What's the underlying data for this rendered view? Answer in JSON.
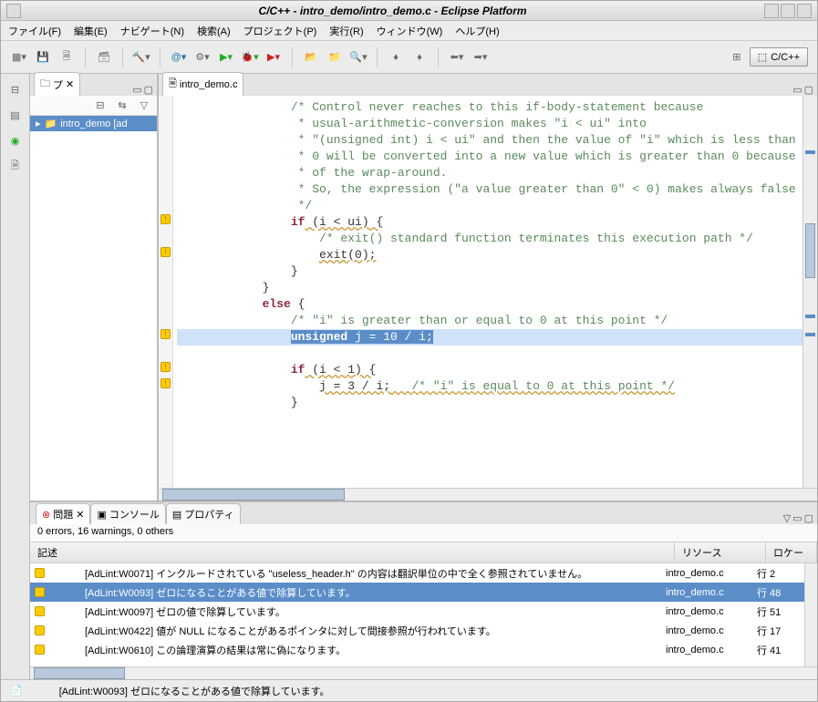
{
  "window": {
    "title": "C/C++ - intro_demo/intro_demo.c - Eclipse Platform"
  },
  "menu": {
    "file": "ファイル(F)",
    "edit": "編集(E)",
    "navigate": "ナビゲート(N)",
    "search": "検索(A)",
    "project": "プロジェクト(P)",
    "run": "実行(R)",
    "window": "ウィンドウ(W)",
    "help": "ヘルプ(H)"
  },
  "perspective": {
    "label": "C/C++"
  },
  "projectTab": "プ",
  "projectItem": "intro_demo [ad",
  "editor": {
    "tab": "intro_demo.c",
    "lines": [
      {
        "t": "comment",
        "indent": 16,
        "text": "/* Control never reaches to this if-body-statement because"
      },
      {
        "t": "comment",
        "indent": 17,
        "text": "* usual-arithmetic-conversion makes \"i < ui\" into"
      },
      {
        "t": "comment",
        "indent": 17,
        "text": "* \"(unsigned int) i < ui\" and then the value of \"i\" which is less than"
      },
      {
        "t": "comment",
        "indent": 17,
        "text": "* 0 will be converted into a new value which is greater than 0 because"
      },
      {
        "t": "comment",
        "indent": 17,
        "text": "* of the wrap-around."
      },
      {
        "t": "comment",
        "indent": 17,
        "text": "* So, the expression (\"a value greater than 0\" < 0) makes always false"
      },
      {
        "t": "comment",
        "indent": 17,
        "text": "*/"
      },
      {
        "t": "if1",
        "indent": 16,
        "kw": "if",
        "cond": " (i < ui) {"
      },
      {
        "t": "comment",
        "indent": 20,
        "text": "/* exit() standard function terminates this execution path */"
      },
      {
        "t": "call",
        "indent": 20,
        "text": "exit(0);"
      },
      {
        "t": "plain",
        "indent": 16,
        "text": "}"
      },
      {
        "t": "plain",
        "indent": 12,
        "text": "}"
      },
      {
        "t": "kw",
        "indent": 12,
        "kw": "else",
        "rest": " {"
      },
      {
        "t": "comment",
        "indent": 16,
        "text": "/* \"i\" is greater than or equal to 0 at this point */"
      },
      {
        "t": "hl",
        "indent": 16,
        "kw": "unsigned",
        "rest": " j = 10 / i;"
      },
      {
        "t": "blank"
      },
      {
        "t": "if2",
        "indent": 16,
        "kw": "if",
        "cond": " (i < 1) {"
      },
      {
        "t": "assign",
        "indent": 20,
        "lhs": "j = 3 / i;",
        "cmt": "   /* \"i\" is equal to 0 at this point */"
      },
      {
        "t": "plain",
        "indent": 16,
        "text": "}"
      }
    ]
  },
  "problemsTabs": {
    "problems": "問題",
    "console": "コンソール",
    "properties": "プロパティ"
  },
  "problemsSummary": "0 errors, 16 warnings, 0 others",
  "problemsCols": {
    "desc": "記述",
    "res": "リソース",
    "loc": "ロケー"
  },
  "problems": [
    {
      "desc": "[AdLint:W0071] インクルードされている \"useless_header.h\" の内容は翻訳単位の中で全く参照されていません。",
      "res": "intro_demo.c",
      "loc": "行 2",
      "sel": false
    },
    {
      "desc": "[AdLint:W0093] ゼロになることがある値で除算しています。",
      "res": "intro_demo.c",
      "loc": "行 48",
      "sel": true
    },
    {
      "desc": "[AdLint:W0097] ゼロの値で除算しています。",
      "res": "intro_demo.c",
      "loc": "行 51",
      "sel": false
    },
    {
      "desc": "[AdLint:W0422] 値が NULL になることがあるポインタに対して間接参照が行われています。",
      "res": "intro_demo.c",
      "loc": "行 17",
      "sel": false
    },
    {
      "desc": "[AdLint:W0610] この論理演算の結果は常に偽になります。",
      "res": "intro_demo.c",
      "loc": "行 41",
      "sel": false
    }
  ],
  "statusMsg": "[AdLint:W0093] ゼロになることがある値で除算しています。"
}
